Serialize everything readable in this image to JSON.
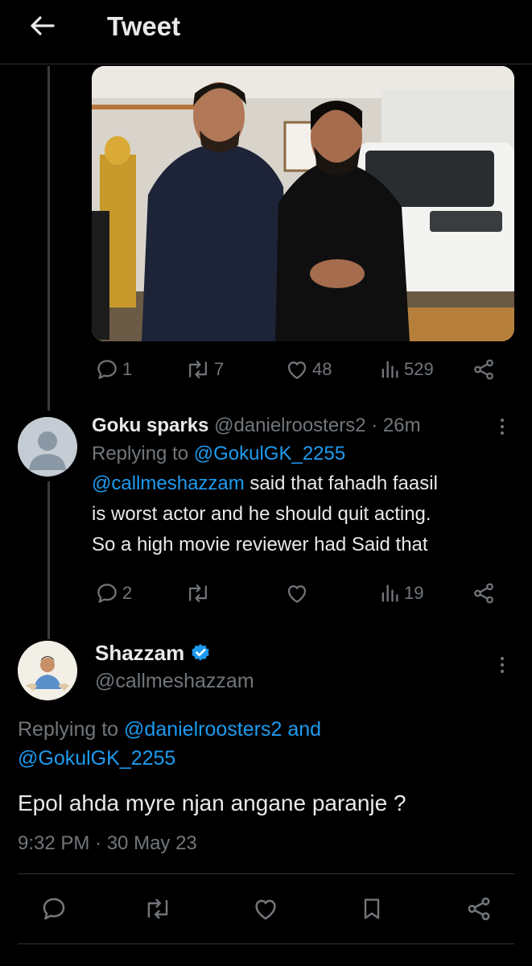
{
  "header": {
    "title": "Tweet"
  },
  "parent_tweet": {
    "stats": {
      "replies": "1",
      "retweets": "7",
      "likes": "48",
      "views": "529"
    }
  },
  "reply": {
    "display_name": "Goku sparks",
    "handle": "@danielroosters2",
    "separator": "·",
    "time": "26m",
    "replying_prefix": "Replying to",
    "replying_to": "@GokulGK_2255",
    "mention": "@callmeshazzam",
    "text_line1": "said that fahadh faasil",
    "text_line2": "is worst actor and he should quit acting.",
    "text_line3": "So a high movie reviewer had Said that",
    "stats": {
      "replies": "2",
      "views": "19"
    }
  },
  "main_tweet": {
    "display_name": "Shazzam",
    "handle": "@callmeshazzam",
    "replying_prefix": "Replying to",
    "replying_to_1": "@danielroosters2",
    "replying_and": "and",
    "replying_to_2": "@GokulGK_2255",
    "text": "Epol ahda myre njan angane paranje ?",
    "timestamp": "9:32 PM · 30 May 23"
  },
  "colors": {
    "accent": "#1d9bf0",
    "muted": "#71767b",
    "background": "#000000",
    "text": "#e7e9ea"
  }
}
